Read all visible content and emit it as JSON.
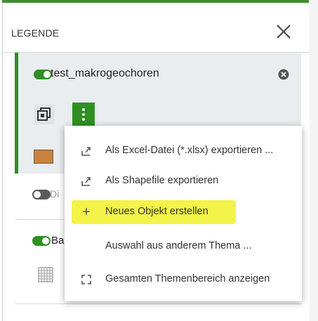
{
  "legend": {
    "title": "LEGENDE",
    "layers": [
      {
        "name": "test_makrogeochoren",
        "enabled": true,
        "swatch_color": "#c8813f"
      },
      {
        "name": "Di",
        "enabled": false
      },
      {
        "name": "Ba",
        "enabled": true
      }
    ]
  },
  "context_menu": {
    "items": [
      {
        "label": "Als Excel-Datei (*.xlsx) exportieren ...",
        "icon": "export-icon"
      },
      {
        "label": "Als Shapefile exportieren",
        "icon": "export-icon"
      },
      {
        "label": "Neues Objekt erstellen",
        "icon": "plus-icon",
        "highlighted": true
      },
      {
        "label": "Auswahl aus anderem Thema ...",
        "icon": ""
      },
      {
        "label": "Gesamten Themenbereich anzeigen",
        "icon": "fullscreen-icon"
      }
    ]
  },
  "colors": {
    "accent_green": "#2f8f23",
    "highlight_yellow": "#f3f34a"
  }
}
